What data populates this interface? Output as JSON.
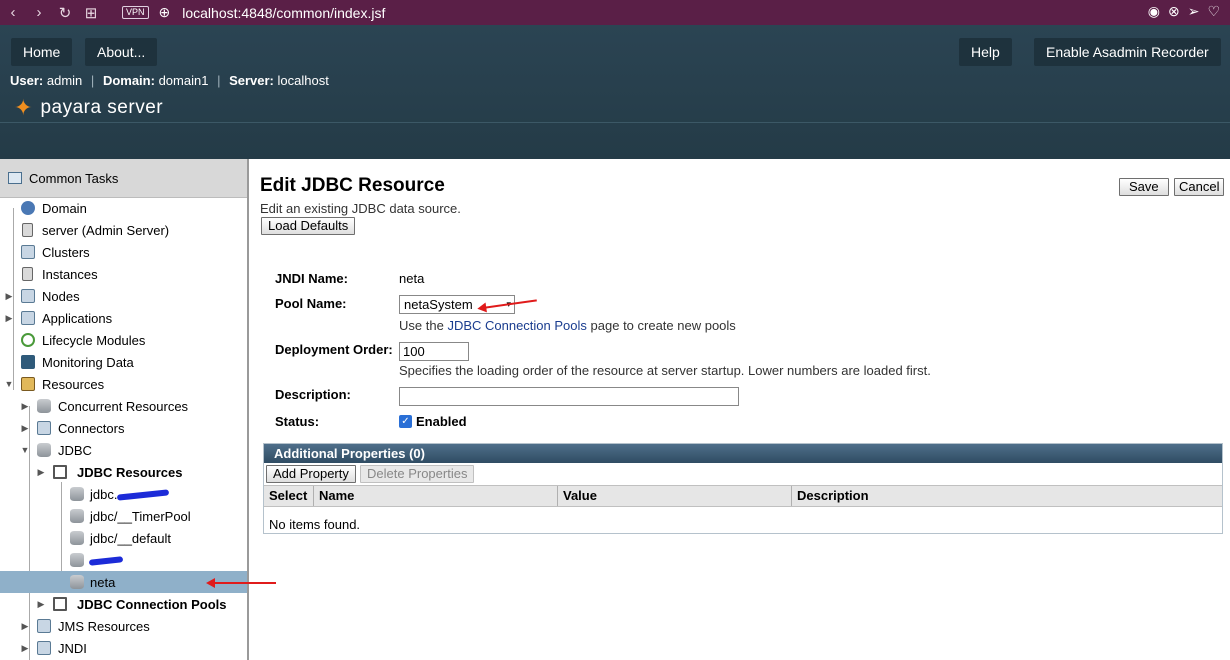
{
  "browser": {
    "vpn": "VPN",
    "url": "localhost:4848/common/index.jsf"
  },
  "header": {
    "home": "Home",
    "about": "About...",
    "help": "Help",
    "recorder": "Enable Asadmin Recorder",
    "user_label": "User:",
    "user": "admin",
    "domain_label": "Domain:",
    "domain": "domain1",
    "server_label": "Server:",
    "server": "localhost",
    "logo_text": "payara server"
  },
  "sidebar": {
    "title": "Common Tasks",
    "items": [
      {
        "label": "Domain"
      },
      {
        "label": "server (Admin Server)"
      },
      {
        "label": "Clusters"
      },
      {
        "label": "Instances"
      },
      {
        "label": "Nodes"
      },
      {
        "label": "Applications"
      },
      {
        "label": "Lifecycle Modules"
      },
      {
        "label": "Monitoring Data"
      },
      {
        "label": "Resources"
      },
      {
        "label": "Concurrent Resources"
      },
      {
        "label": "Connectors"
      },
      {
        "label": "JDBC"
      },
      {
        "label": "JDBC Resources"
      },
      {
        "label": "jdbc."
      },
      {
        "label": "jdbc/__TimerPool"
      },
      {
        "label": "jdbc/__default"
      },
      {
        "label": ""
      },
      {
        "label": "neta"
      },
      {
        "label": "JDBC Connection Pools"
      },
      {
        "label": "JMS Resources"
      },
      {
        "label": "JNDI"
      }
    ]
  },
  "main": {
    "title": "Edit JDBC Resource",
    "help": "Edit an existing JDBC data source.",
    "load_defaults": "Load Defaults",
    "save": "Save",
    "cancel": "Cancel",
    "jndi_label": "JNDI Name:",
    "jndi_value": "neta",
    "pool_label": "Pool Name:",
    "pool_value": "netaSystem",
    "pool_help_pre": "Use the",
    "pool_help_link": "JDBC Connection Pools",
    "pool_help_post": "page to create new pools",
    "order_label": "Deployment Order:",
    "order_value": "100",
    "order_help": "Specifies the loading order of the resource at server startup. Lower numbers are loaded first.",
    "desc_label": "Description:",
    "desc_value": "",
    "status_label": "Status:",
    "status_value": "Enabled",
    "props": {
      "title": "Additional Properties (0)",
      "add": "Add Property",
      "delete": "Delete Properties",
      "columns": [
        "Select",
        "Name",
        "Value",
        "Description"
      ],
      "empty": "No items found."
    }
  },
  "colors": {
    "browser_bar": "#5a1f47",
    "header": "#2b4453",
    "selected_row": "#8fb0c9",
    "annotation_arrow": "#e01b1b"
  }
}
